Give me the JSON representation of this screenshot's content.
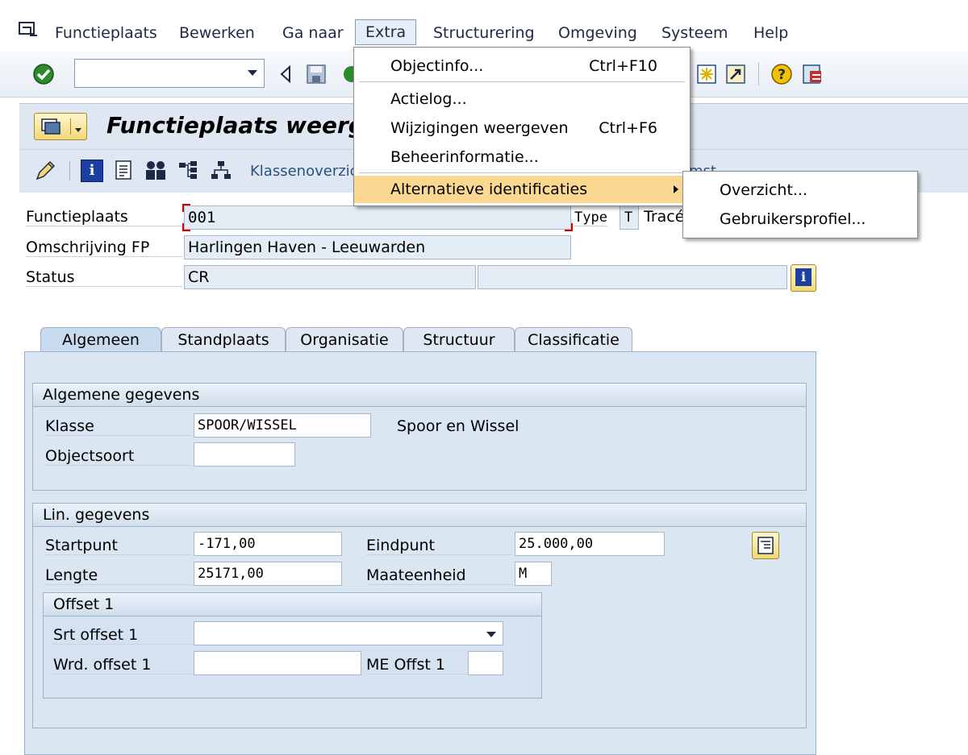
{
  "menubar": {
    "items": [
      "Functieplaats",
      "Bewerken",
      "Ga naar",
      "Extra",
      "Structurering",
      "Omgeving",
      "Systeem",
      "Help"
    ]
  },
  "toolbar": {
    "command_value": ""
  },
  "title": {
    "text": "Functieplaats weergeven",
    "toolbar_link_1": "Klassenoverzicht",
    "toolbar_link_2": "mst"
  },
  "header": {
    "functieplaats_label": "Functieplaats",
    "functieplaats_value": "001",
    "type_label": "Type",
    "type_value": "T",
    "trace_label": "Tracé",
    "omschrijving_label": "Omschrijving FP",
    "omschrijving_value": "Harlingen Haven - Leeuwarden",
    "status_label": "Status",
    "status_value": "CR",
    "status_value_2": ""
  },
  "tabs": [
    "Algemeen",
    "Standplaats",
    "Organisatie",
    "Structuur",
    "Classificatie"
  ],
  "algemeen": {
    "title": "Algemene gegevens",
    "klasse_label": "Klasse",
    "klasse_value": "SPOOR/WISSEL",
    "klasse_desc": "Spoor en Wissel",
    "objectsoort_label": "Objectsoort",
    "objectsoort_value": ""
  },
  "lin": {
    "title": "Lin. gegevens",
    "startpunt_label": "Startpunt",
    "startpunt_value": "-171,00",
    "eindpunt_label": "Eindpunt",
    "eindpunt_value": "25.000,00",
    "lengte_label": "Lengte",
    "lengte_value": "25171,00",
    "maateenheid_label": "Maateenheid",
    "maateenheid_value": "M",
    "offset": {
      "title": "Offset 1",
      "srt_label": "Srt offset 1",
      "srt_value": "",
      "wrd_label": "Wrd. offset 1",
      "wrd_value": "",
      "me_label": "ME Offst 1",
      "me_value": ""
    }
  },
  "extra_menu": {
    "items": [
      {
        "label": "Objectinfo...",
        "shortcut": "Ctrl+F10"
      },
      {
        "label": "Actielog...",
        "shortcut": ""
      },
      {
        "label": "Wijzigingen weergeven",
        "shortcut": "Ctrl+F6"
      },
      {
        "label": "Beheerinformatie...",
        "shortcut": ""
      },
      {
        "label": "Alternatieve identificaties",
        "shortcut": ""
      }
    ]
  },
  "submenu": {
    "items": [
      "Overzicht...",
      "Gebruikersprofiel..."
    ]
  },
  "colors": {
    "highlight": "#fbd892",
    "panel": "#dbe6f3",
    "accent": "#1c2a44"
  }
}
